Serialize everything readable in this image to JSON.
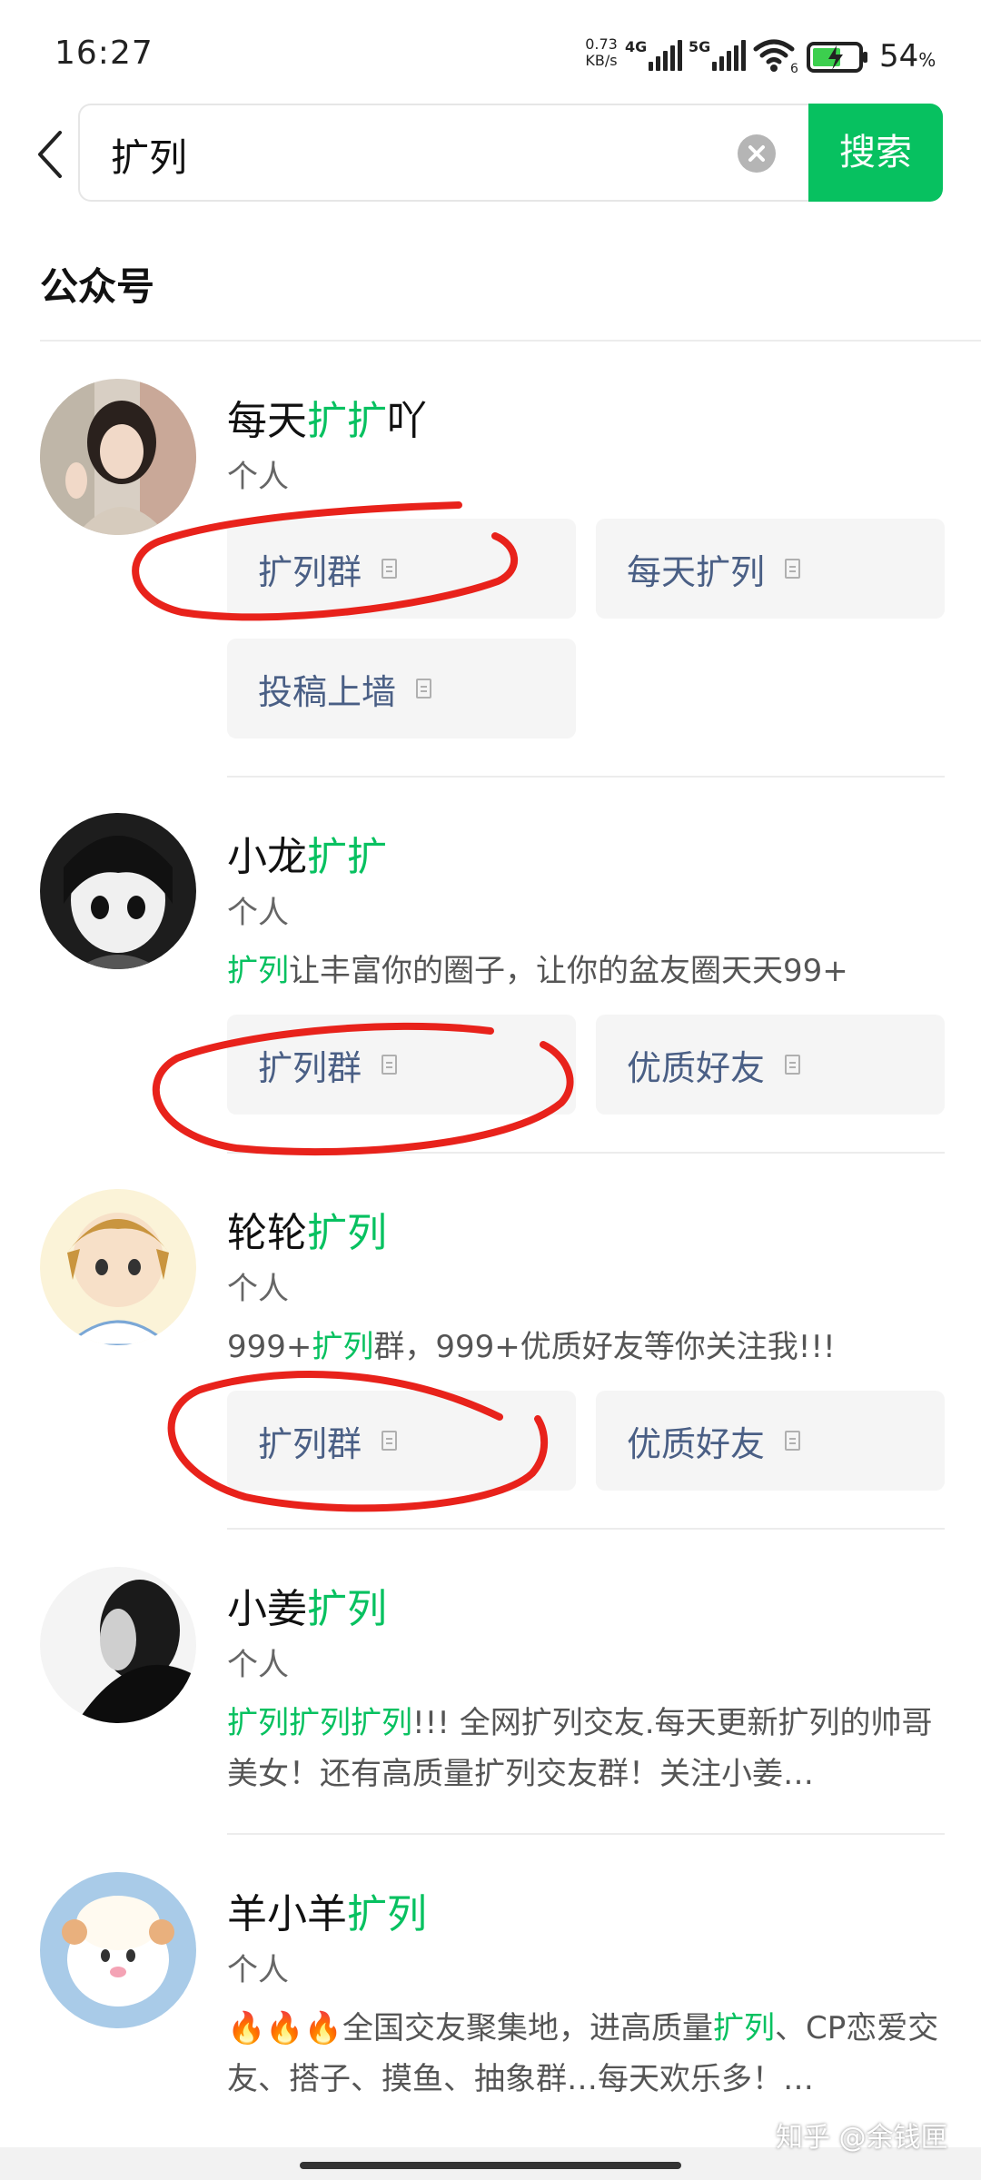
{
  "status": {
    "time": "16:27",
    "net_speed_value": "0.73",
    "net_speed_unit": "KB/s",
    "sim1": "4G",
    "sim2": "5G",
    "wifi_badge": "6",
    "battery_value": "54",
    "battery_unit": "%"
  },
  "search": {
    "query": "扩列",
    "button_label": "搜索"
  },
  "section_title": "公众号",
  "results": [
    {
      "name_plain": "每天",
      "name_hl": "扩扩",
      "name_suffix": "吖",
      "type": "个人",
      "chips": [
        "扩列群",
        "每天扩列",
        "投稿上墙"
      ]
    },
    {
      "name_plain": "小龙",
      "name_hl": "扩扩",
      "type": "个人",
      "desc_hl": "扩列",
      "desc_rest": "让丰富你的圈子，让你的盆友圈天天99+",
      "chips": [
        "扩列群",
        "优质好友"
      ]
    },
    {
      "name_plain": "轮轮",
      "name_hl": "扩列",
      "type": "个人",
      "desc_pre": "999+",
      "desc_hl": "扩列",
      "desc_rest": "群，999+优质好友等你关注我!!!",
      "chips": [
        "扩列群",
        "优质好友"
      ]
    },
    {
      "name_plain": "小姜",
      "name_hl": "扩列",
      "type": "个人",
      "desc_hl": "扩列扩列扩列",
      "desc_rest": "!!! 全网扩列交友.每天更新扩列的帅哥美女！还有高质量扩列交友群！关注小姜…"
    },
    {
      "name_plain": "羊小羊",
      "name_hl": "扩列",
      "type": "个人",
      "desc_pre": "🔥🔥🔥全国交友聚集地，进高质量",
      "desc_hl": "扩列",
      "desc_rest": "、CP恋爱交友、搭子、摸鱼、抽象群…每天欢乐多！…"
    }
  ],
  "watermark": "知乎 @余钱匣",
  "colors": {
    "accent": "#07c160",
    "chip_text": "#4a5f85",
    "annotation": "#e8221b"
  }
}
